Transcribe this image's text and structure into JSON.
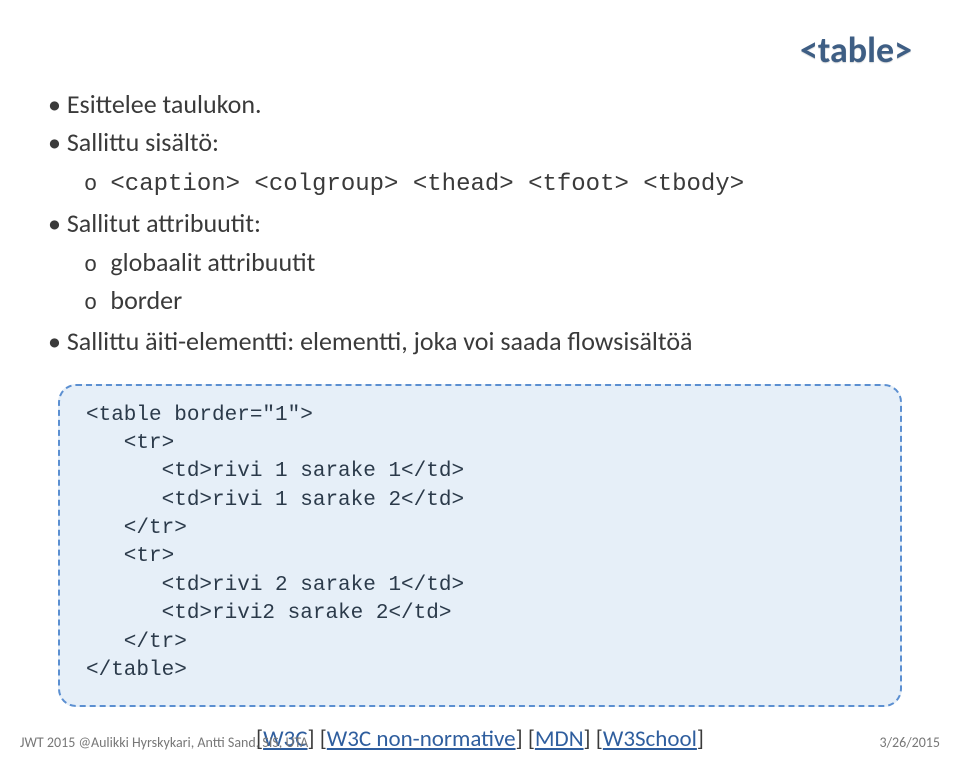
{
  "title_tag": "<table>",
  "bullets": {
    "b1": "Esittelee taulukon.",
    "b2": "Sallittu sisältö:",
    "b2_sub1": "<caption> <colgroup> <thead> <tfoot> <tbody>",
    "b3": "Sallitut attribuutit:",
    "b3_sub1": "globaalit attribuutit",
    "b3_sub2": "border",
    "b4": "Sallittu äiti-elementti: elementti, joka voi saada flowsisältöä"
  },
  "code": "<table border=\"1\">\n   <tr>\n      <td>rivi 1 sarake 1</td>\n      <td>rivi 1 sarake 2</td>\n   </tr>\n   <tr>\n      <td>rivi 2 sarake 1</td>\n      <td>rivi2 sarake 2</td>\n   </tr>\n</table>",
  "refs": {
    "w3c": "W3C",
    "w3c_nn": "W3C non-normative",
    "mdn": "MDN",
    "w3s": "W3School"
  },
  "footer": {
    "left": "JWT 2015 @Aulikki Hyrskykari, Antti Sand, SIS, UTA",
    "right": "3/26/2015"
  }
}
